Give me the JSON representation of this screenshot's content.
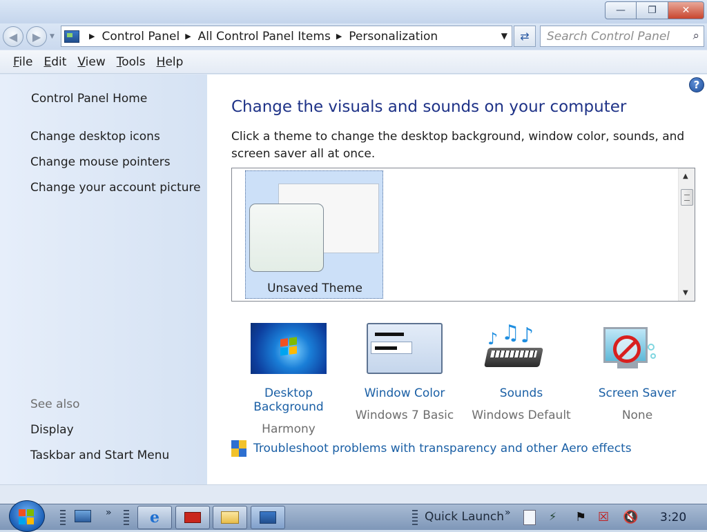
{
  "window": {
    "min_label": "—",
    "max_label": "❐",
    "close_label": "✕"
  },
  "nav": {
    "breadcrumb": [
      "Control Panel",
      "All Control Panel Items",
      "Personalization"
    ],
    "search_placeholder": "Search Control Panel"
  },
  "menu": [
    {
      "accel": "F",
      "rest": "ile"
    },
    {
      "accel": "E",
      "rest": "dit"
    },
    {
      "accel": "V",
      "rest": "iew"
    },
    {
      "accel": "T",
      "rest": "ools"
    },
    {
      "accel": "H",
      "rest": "elp"
    }
  ],
  "sidebar": {
    "home": "Control Panel Home",
    "links": [
      "Change desktop icons",
      "Change mouse pointers",
      "Change your account picture"
    ],
    "see_also": "See also",
    "see_also_links": [
      "Display",
      "Taskbar and Start Menu"
    ]
  },
  "main": {
    "heading": "Change the visuals and sounds on your computer",
    "description": "Click a theme to change the desktop background, window color, sounds, and screen saver all at once.",
    "themes": [
      {
        "label": "Unsaved Theme",
        "selected": true
      }
    ],
    "tiles": [
      {
        "title": "Desktop Background",
        "value": "Harmony",
        "icon": "desktop-background-icon"
      },
      {
        "title": "Window Color",
        "value": "Windows 7 Basic",
        "icon": "window-color-icon"
      },
      {
        "title": "Sounds",
        "value": "Windows Default",
        "icon": "sounds-icon"
      },
      {
        "title": "Screen Saver",
        "value": "None",
        "icon": "screen-saver-icon"
      }
    ],
    "troubleshoot": "Troubleshoot problems with transparency and other Aero effects",
    "help_label": "?"
  },
  "taskbar": {
    "quick_launch": "Quick Launch",
    "time": "3:20"
  },
  "colors": {
    "link": "#1a5fa5",
    "heading": "#1e3287",
    "selection": "#cce0f8"
  }
}
